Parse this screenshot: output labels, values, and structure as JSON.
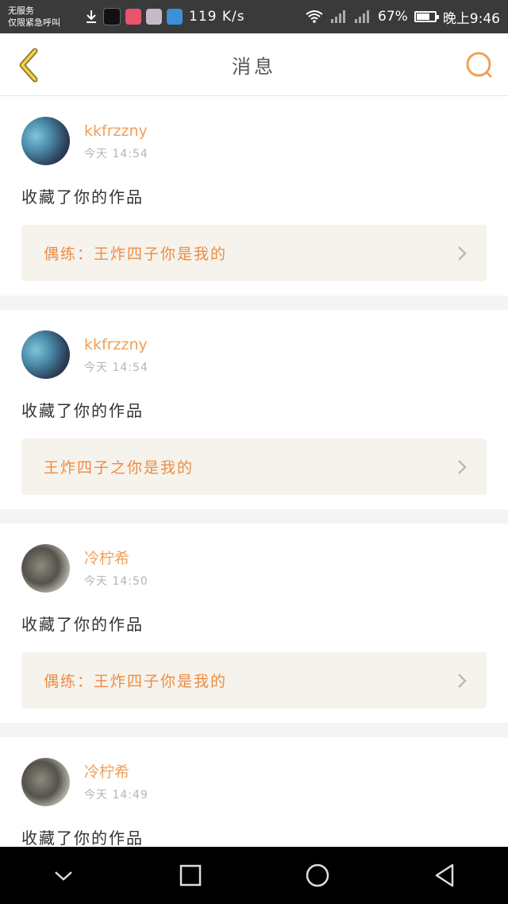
{
  "status_bar": {
    "carrier_line1": "无服务",
    "carrier_line2": "仅限紧急呼叫",
    "app_icons": [
      "download-icon",
      "tiktok-icon",
      "app-icon",
      "app-icon",
      "app-icon"
    ],
    "net_speed": "119 K/s",
    "battery_percent": "67%",
    "battery_level": 0.67,
    "time": "晚上9:46"
  },
  "header": {
    "title": "消息",
    "back_icon": "chevron-left-icon",
    "search_icon": "search-icon",
    "accent_color": "#f0a05a"
  },
  "messages": [
    {
      "user": "kkfrzzny",
      "time": "今天 14:54",
      "action": "收藏了你的作品",
      "work": "偶练：王炸四子你是我的"
    },
    {
      "user": "kkfrzzny",
      "time": "今天 14:54",
      "action": "收藏了你的作品",
      "work": "王炸四子之你是我的"
    },
    {
      "user": "冷柠希",
      "time": "今天 14:50",
      "action": "收藏了你的作品",
      "work": "偶练：王炸四子你是我的"
    },
    {
      "user": "冷柠希",
      "time": "今天 14:49",
      "action": "收藏了你的作品",
      "work": ""
    }
  ],
  "nav_bar": {
    "buttons": [
      "collapse-icon",
      "recents-icon",
      "home-icon",
      "back-icon"
    ]
  }
}
